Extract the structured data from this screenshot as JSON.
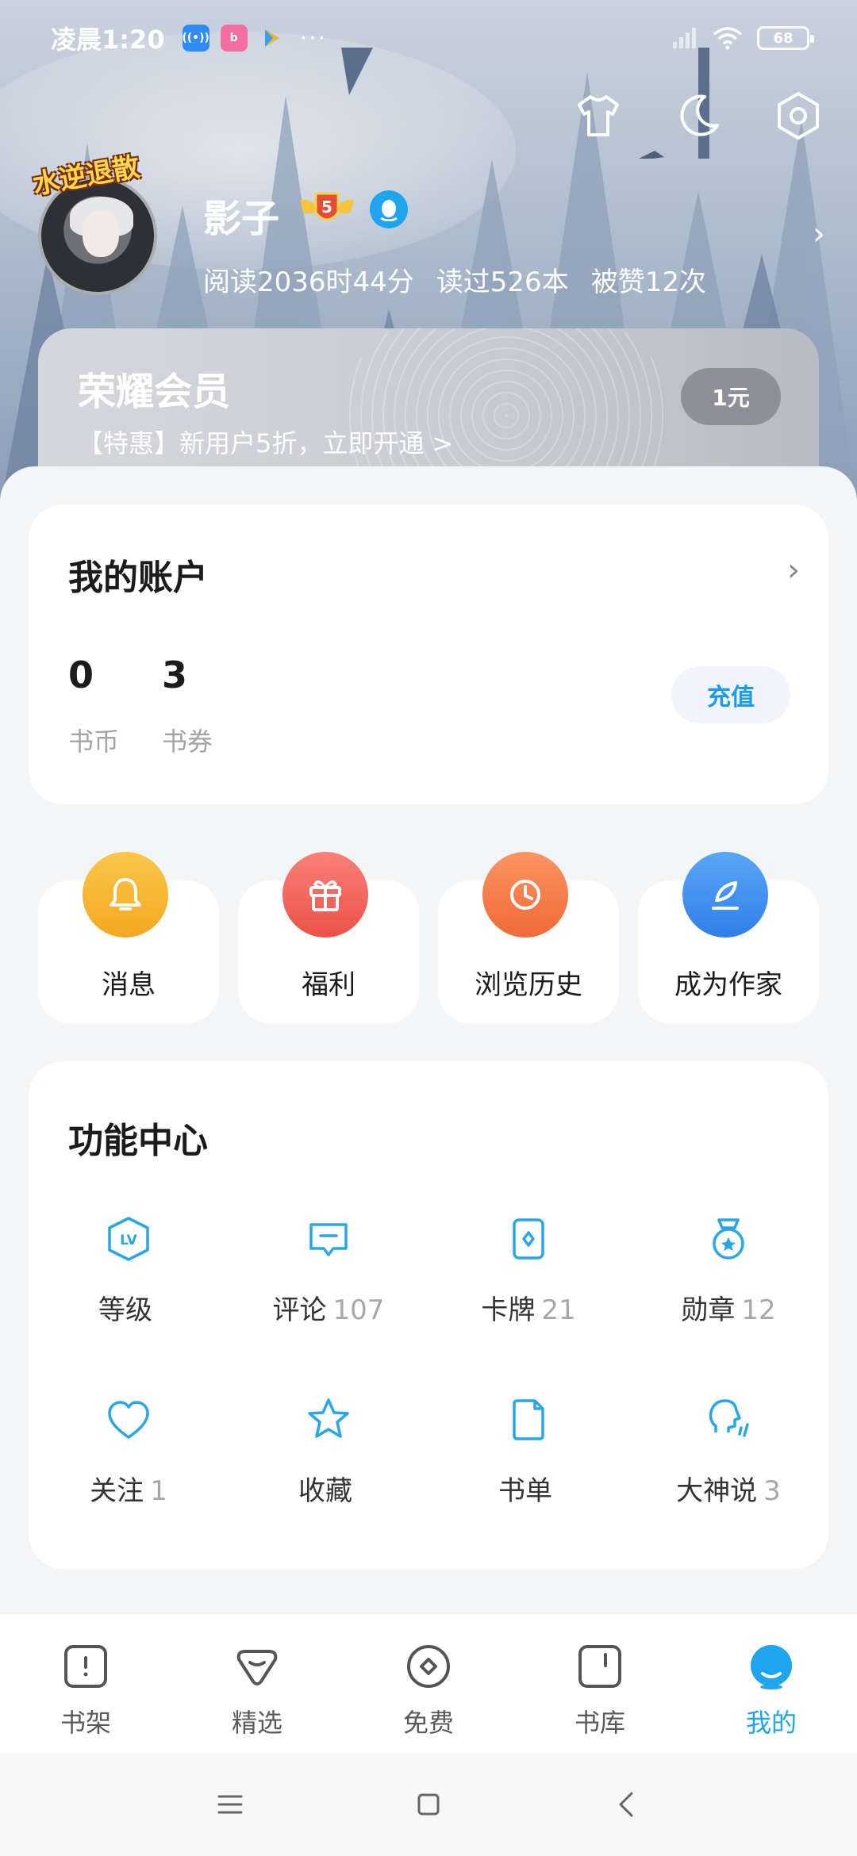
{
  "status_bar": {
    "time": "凌晨1:20",
    "more": "···",
    "battery": "68"
  },
  "profile": {
    "frame_text": "水逆退散",
    "name": "影子",
    "level": "5",
    "stats": [
      "阅读2036时44分",
      "读过526本",
      "被赞12次"
    ]
  },
  "vip": {
    "title": "荣耀会员",
    "subtitle": "【特惠】新用户5折，立即开通 >",
    "price_button": "1元"
  },
  "account": {
    "title": "我的账户",
    "coins_value": "0",
    "coins_label": "书币",
    "vouchers_value": "3",
    "vouchers_label": "书券",
    "recharge": "充值"
  },
  "quick_actions": [
    {
      "label": "消息",
      "icon": "bell-icon",
      "color": "#f7b330"
    },
    {
      "label": "福利",
      "icon": "gift-icon",
      "color": "#f0645c"
    },
    {
      "label": "浏览历史",
      "icon": "clock-icon",
      "color": "#f47f4a"
    },
    {
      "label": "成为作家",
      "icon": "pen-icon",
      "color": "#3d8ff0"
    }
  ],
  "function_center": {
    "title": "功能中心",
    "items": [
      {
        "label": "等级",
        "count": ""
      },
      {
        "label": "评论",
        "count": "107"
      },
      {
        "label": "卡牌",
        "count": "21"
      },
      {
        "label": "勋章",
        "count": "12"
      },
      {
        "label": "关注",
        "count": "1"
      },
      {
        "label": "收藏",
        "count": ""
      },
      {
        "label": "书单",
        "count": ""
      },
      {
        "label": "大神说",
        "count": "3"
      }
    ]
  },
  "tabs": [
    {
      "label": "书架"
    },
    {
      "label": "精选"
    },
    {
      "label": "免费"
    },
    {
      "label": "书库"
    },
    {
      "label": "我的",
      "active": true
    }
  ],
  "colors": {
    "accent": "#1fa4ee",
    "icon_blue": "#2aa6e6"
  }
}
